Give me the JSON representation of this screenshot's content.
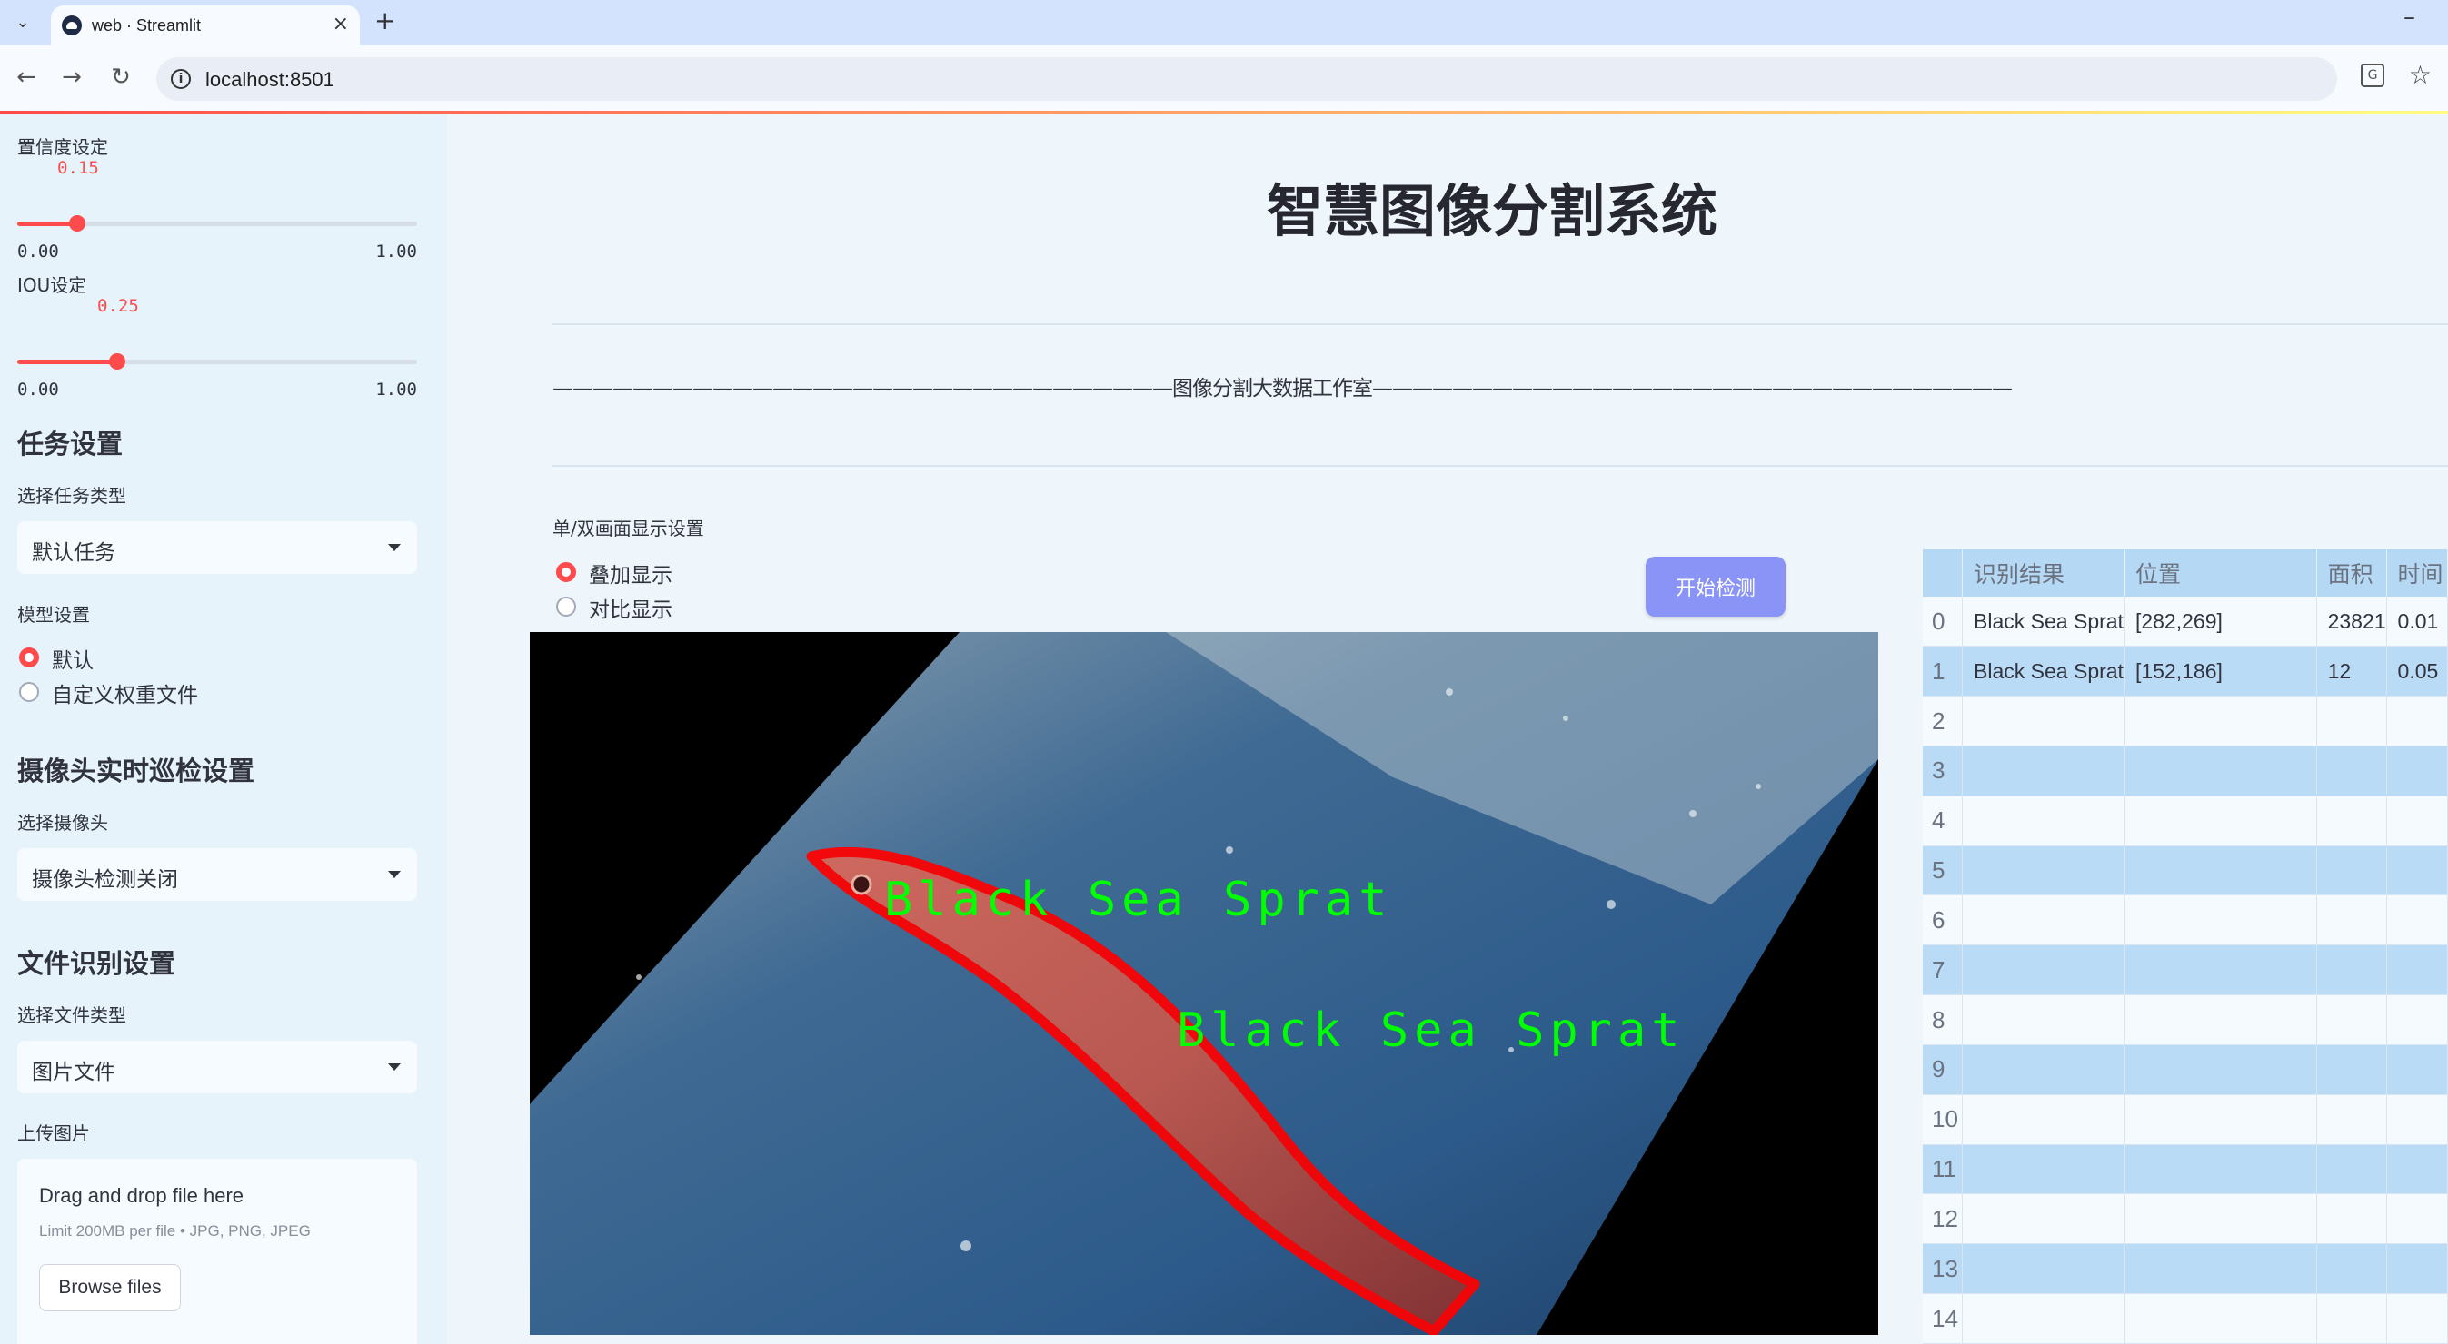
{
  "browser": {
    "tab_title": "web · Streamlit",
    "url": "localhost:8501",
    "tab_close": "×",
    "new_tab": "+",
    "minimize": "–"
  },
  "sidebar": {
    "confidence_label": "置信度设定",
    "confidence": {
      "value": "0.15",
      "min": "0.00",
      "max": "1.00",
      "fraction": 0.15
    },
    "iou_label": "IOU设定",
    "iou": {
      "value": "0.25",
      "min": "0.00",
      "max": "1.00",
      "fraction": 0.25
    },
    "task_heading": "任务设置",
    "task_type_label": "选择任务类型",
    "task_type_value": "默认任务",
    "model_label": "模型设置",
    "model_options": [
      "默认",
      "自定义权重文件"
    ],
    "model_selected": 0,
    "camera_heading": "摄像头实时巡检设置",
    "camera_label": "选择摄像头",
    "camera_value": "摄像头检测关闭",
    "file_heading": "文件识别设置",
    "file_type_label": "选择文件类型",
    "file_type_value": "图片文件",
    "upload_label": "上传图片",
    "uploader": {
      "title": "Drag and drop file here",
      "limit": "Limit 200MB per file • JPG, PNG, JPEG",
      "button": "Browse files"
    }
  },
  "main": {
    "title": "智慧图像分割系统",
    "divider_text": "———————————————————————————————图像分割大数据工作室————————————————————————————————",
    "display_mode_label": "单/双画面显示设置",
    "display_options": [
      "叠加显示",
      "对比显示"
    ],
    "display_selected": 0,
    "start_button": "开始检测",
    "detections": [
      {
        "label": "Black Sea Sprat"
      },
      {
        "label": "Black Sea Sprat"
      }
    ]
  },
  "table": {
    "columns": [
      "",
      "识别结果",
      "位置",
      "面积",
      "时间"
    ],
    "rows": [
      [
        "0",
        "Black Sea Sprat",
        "[282,269]",
        "23821",
        "0.01"
      ],
      [
        "1",
        "Black Sea Sprat",
        "[152,186]",
        "12",
        "0.05"
      ],
      [
        "2",
        "",
        "",
        "",
        ""
      ],
      [
        "3",
        "",
        "",
        "",
        ""
      ],
      [
        "4",
        "",
        "",
        "",
        ""
      ],
      [
        "5",
        "",
        "",
        "",
        ""
      ],
      [
        "6",
        "",
        "",
        "",
        ""
      ],
      [
        "7",
        "",
        "",
        "",
        ""
      ],
      [
        "8",
        "",
        "",
        "",
        ""
      ],
      [
        "9",
        "",
        "",
        "",
        ""
      ],
      [
        "10",
        "",
        "",
        "",
        ""
      ],
      [
        "11",
        "",
        "",
        "",
        ""
      ],
      [
        "12",
        "",
        "",
        "",
        ""
      ],
      [
        "13",
        "",
        "",
        "",
        ""
      ],
      [
        "14",
        "",
        "",
        "",
        ""
      ]
    ]
  },
  "colors": {
    "accent": "#ff4b4b",
    "button": "#8a93f6",
    "mask_outline": "#ff0000",
    "label_text": "#00ff00"
  }
}
